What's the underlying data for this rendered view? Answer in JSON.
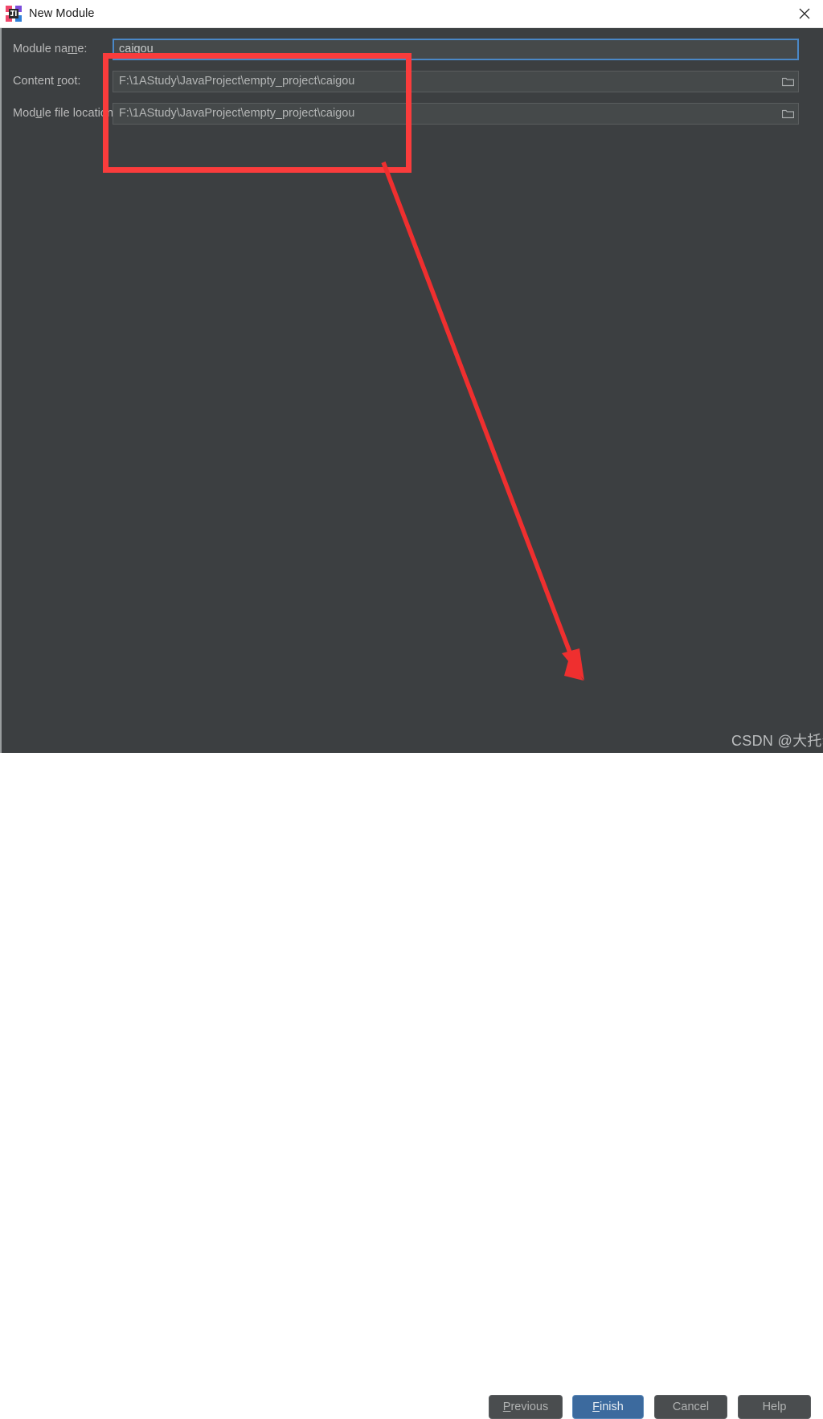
{
  "window": {
    "title": "New Module",
    "app_icon": "intellij-idea-icon",
    "close_label": "✕"
  },
  "form": {
    "rows": [
      {
        "label_before": "Module na",
        "label_mnemonic": "m",
        "label_after": "e:",
        "value": "caigou",
        "focused": true,
        "browse": false
      },
      {
        "label_before": "Content ",
        "label_mnemonic": "r",
        "label_after": "oot:",
        "value": "F:\\1AStudy\\JavaProject\\empty_project\\caigou",
        "focused": false,
        "browse": true
      },
      {
        "label_before": "Mod",
        "label_mnemonic": "u",
        "label_after": "le file location:",
        "value": "F:\\1AStudy\\JavaProject\\empty_project\\caigou",
        "focused": false,
        "browse": true
      }
    ]
  },
  "annotations": {
    "rect_color": "#fa3c3c",
    "arrow_color": "#f03030",
    "arrow_start": "475,202",
    "arrow_end": "724,847"
  },
  "footer": {
    "previous": {
      "before": "",
      "mnemonic": "P",
      "after": "revious"
    },
    "finish": {
      "before": "",
      "mnemonic": "F",
      "after": "inish"
    },
    "cancel": {
      "before": "Cancel",
      "mnemonic": "",
      "after": ""
    },
    "help": {
      "before": "Help",
      "mnemonic": "",
      "after": ""
    }
  },
  "watermark": {
    "text": "CSDN @大托尔"
  },
  "colors": {
    "dialog_bg": "#3c3f41",
    "field_bg": "#45494a",
    "focus_border": "#4a88c7",
    "primary_button": "#3c6a9e",
    "annotation_red": "#fa3c3c"
  }
}
